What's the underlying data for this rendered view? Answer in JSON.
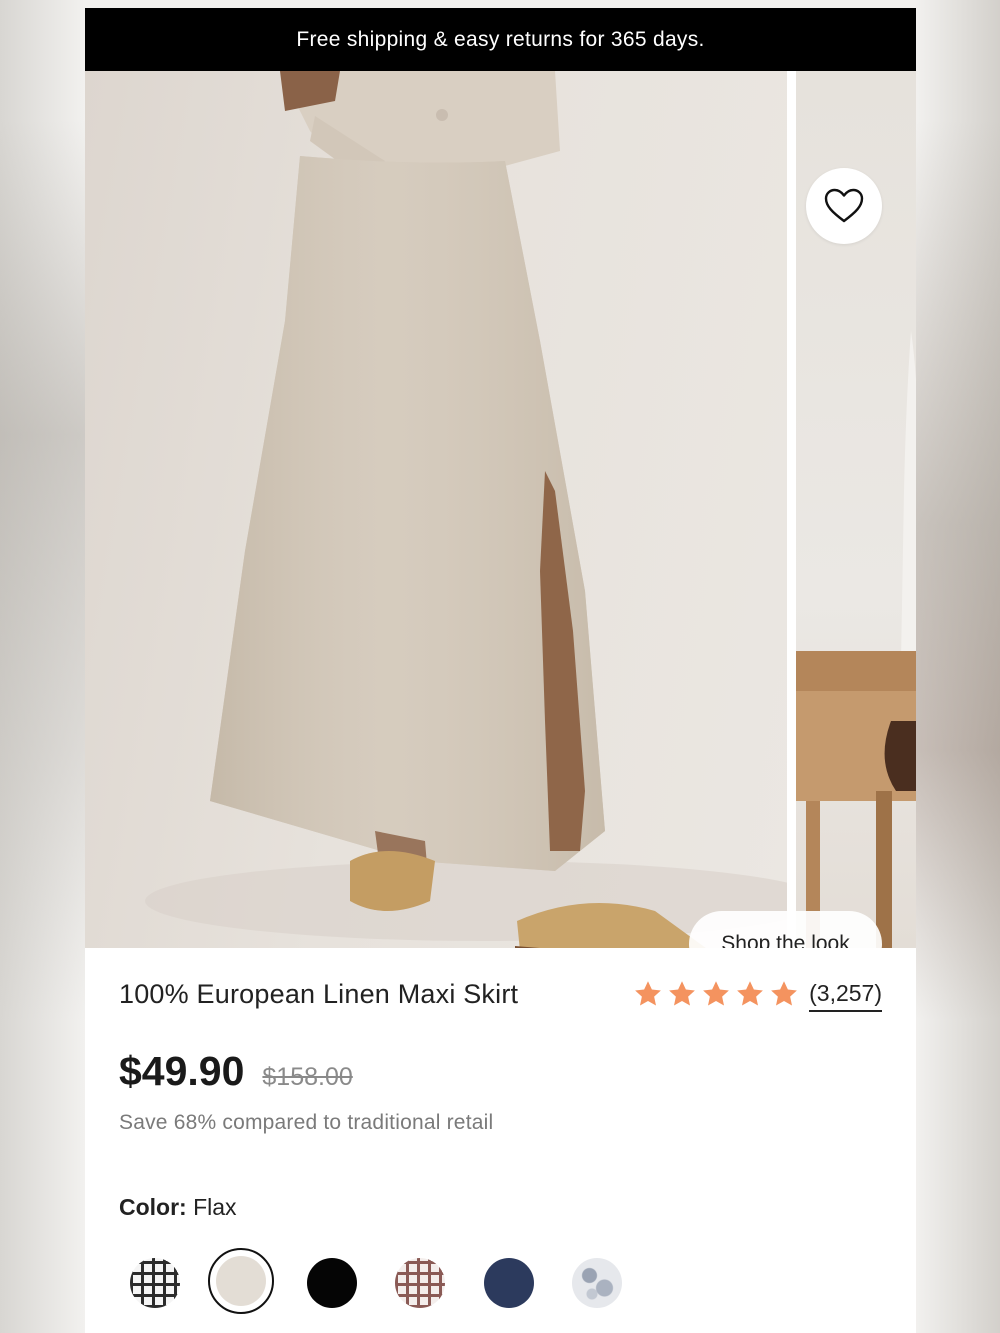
{
  "promo_banner": {
    "text": "Free shipping & easy returns for 365 days."
  },
  "gallery": {
    "wishlist_icon": "heart-icon",
    "shop_the_look_label": "Shop the look"
  },
  "product": {
    "title": "100% European Linen Maxi Skirt",
    "rating": {
      "stars": 5,
      "review_count": "(3,257)",
      "star_color": "#f4935f"
    },
    "price": "$49.90",
    "original_price": "$158.00",
    "savings_text": "Save 68% compared to traditional retail",
    "color": {
      "label": "Color:",
      "selected": "Flax",
      "swatches": [
        {
          "name": "black-white-check",
          "pattern": "check",
          "color": "#2b2b2b"
        },
        {
          "name": "flax",
          "pattern": "solid",
          "color": "#e3ddd5",
          "selected": true
        },
        {
          "name": "black",
          "pattern": "solid",
          "color": "#050505"
        },
        {
          "name": "brown-check",
          "pattern": "check",
          "color": "#8a5a55"
        },
        {
          "name": "navy",
          "pattern": "solid",
          "color": "#2c3a5d"
        },
        {
          "name": "floral",
          "pattern": "floral",
          "color": "#c9ccd2"
        }
      ]
    }
  }
}
